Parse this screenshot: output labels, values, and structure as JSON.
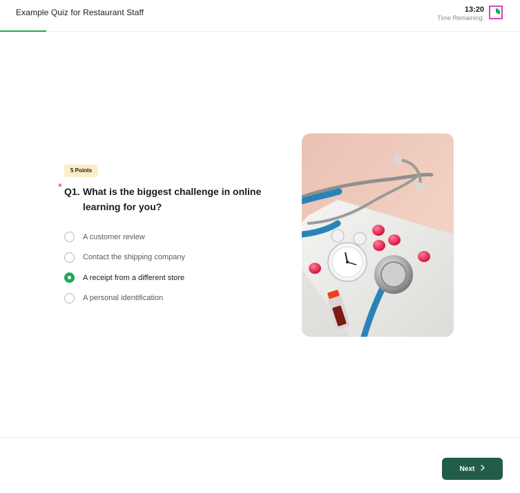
{
  "header": {
    "title": "Example Quiz for Restaurant Staff",
    "progress_fraction": 0.089,
    "timer": {
      "value": "13:20",
      "label": "Time Remaining:"
    }
  },
  "question": {
    "points_label": "5 Points",
    "required_marker": "*",
    "number": "Q1.",
    "text": "What is the biggest challenge in online learning for you?",
    "options": [
      {
        "label": "A customer review",
        "selected": false
      },
      {
        "label": "Contact the shipping company",
        "selected": false
      },
      {
        "label": "A receipt from a different store",
        "selected": true
      },
      {
        "label": "A personal identification",
        "selected": false
      }
    ]
  },
  "illustration": {
    "subject": "stethoscope, alarm clock, red pills and a blood sample vial on a pink background"
  },
  "footer": {
    "next_label": "Next"
  },
  "colors": {
    "accent_green": "#1fa855",
    "button_bg": "#245c4b",
    "badge_bg": "#fbeec4",
    "required_red": "#e53935",
    "timer_icon_border": "#e040c8"
  },
  "icons": {
    "timer": "pie-timer-icon",
    "next": "chevron-right-icon"
  }
}
